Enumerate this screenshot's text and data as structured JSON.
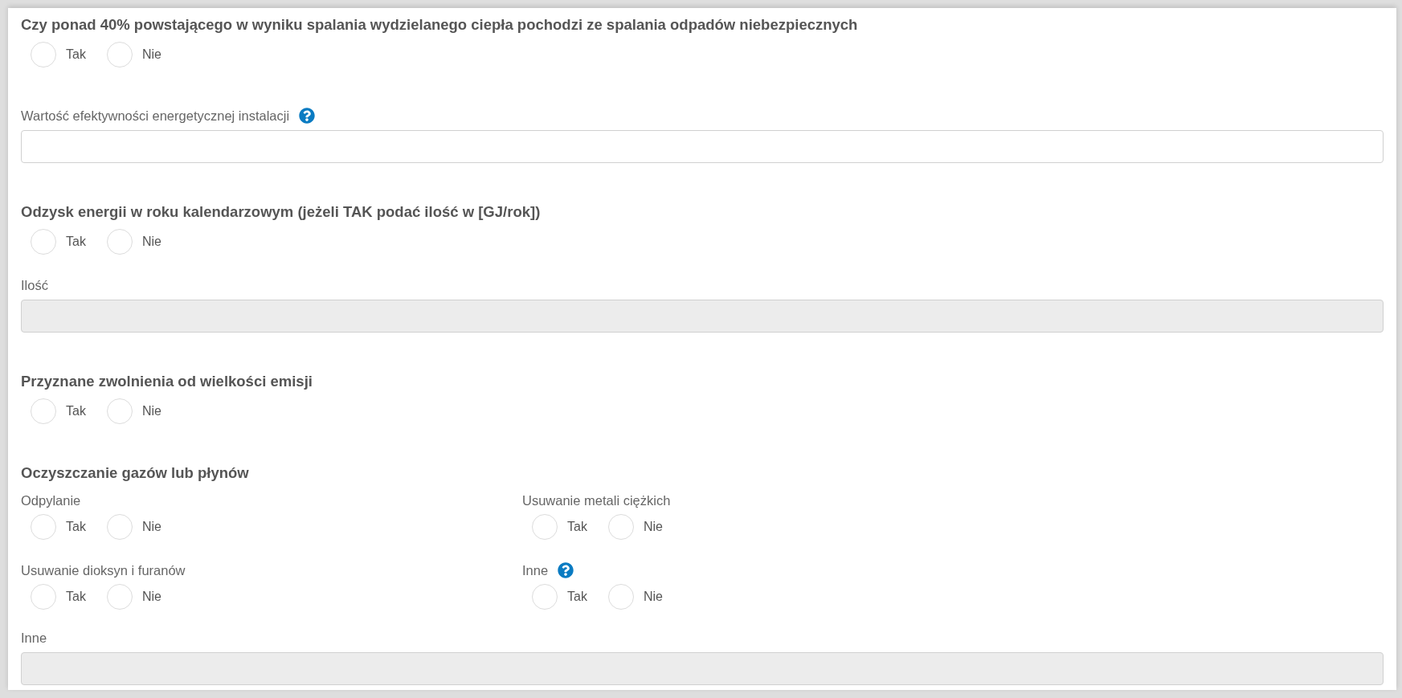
{
  "blocks": [
    {
      "kind": "question",
      "label": "Czy ponad 40% powstającego w wyniku spalania wydzielanego ciepła pochodzi ze spalania odpadów niebezpiecznych",
      "options": [
        {
          "label": "Tak",
          "selected": false
        },
        {
          "label": "Nie",
          "selected": false
        }
      ]
    },
    {
      "kind": "field",
      "label": "Wartość efektywności energetycznej instalacji",
      "help": true,
      "disabled": false
    },
    {
      "kind": "question",
      "label": "Odzysk energii w roku kalendarzowym (jeżeli TAK podać ilość w [GJ/rok])",
      "options": [
        {
          "label": "Tak",
          "selected": false
        },
        {
          "label": "Nie",
          "selected": false
        }
      ],
      "field": {
        "label": "Ilość",
        "disabled": true
      }
    },
    {
      "kind": "question",
      "label": "Przyznane zwolnienia od wielkości emisji",
      "options": [
        {
          "label": "Tak",
          "selected": false
        },
        {
          "label": "Nie",
          "selected": false
        }
      ]
    },
    {
      "kind": "group",
      "label": "Oczyszczanie gazów lub płynów",
      "questions": [
        {
          "label": "Odpylanie",
          "help": false,
          "options": [
            {
              "label": "Tak",
              "selected": false
            },
            {
              "label": "Nie",
              "selected": false
            }
          ]
        },
        {
          "label": "Usuwanie metali ciężkich",
          "help": false,
          "options": [
            {
              "label": "Tak",
              "selected": false
            },
            {
              "label": "Nie",
              "selected": false
            }
          ]
        },
        {
          "label": "Usuwanie dioksyn i furanów",
          "help": false,
          "options": [
            {
              "label": "Tak",
              "selected": false
            },
            {
              "label": "Nie",
              "selected": false
            }
          ]
        },
        {
          "label": "Inne",
          "help": true,
          "options": [
            {
              "label": "Tak",
              "selected": false
            },
            {
              "label": "Nie",
              "selected": false
            }
          ]
        }
      ],
      "field": {
        "label": "Inne",
        "disabled": true
      }
    }
  ]
}
